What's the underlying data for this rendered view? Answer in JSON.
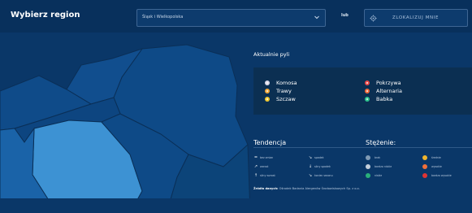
{
  "header": {
    "title": "Wybierz region",
    "region_select": {
      "value": "Śląsk i Wielkopolska"
    },
    "or_label": "lub",
    "locate_button": {
      "label": "ZLOKALIZUJ MNIE"
    }
  },
  "current_pollen": {
    "title": "Aktualnie pyli",
    "left": [
      {
        "name": "Komosa",
        "color": "#d8d8e8"
      },
      {
        "name": "Trawy",
        "color": "#f0a83c"
      },
      {
        "name": "Szczaw",
        "color": "#f0c830"
      }
    ],
    "right": [
      {
        "name": "Pokrzywa",
        "color": "#e84a4a"
      },
      {
        "name": "Alternaria",
        "color": "#f06a3c"
      },
      {
        "name": "Babka",
        "color": "#2ec48e"
      }
    ]
  },
  "trend": {
    "title": "Tendencja",
    "items": [
      {
        "symbol": "=",
        "text": "bez zmian"
      },
      {
        "symbol": "↘",
        "text": "spadek"
      },
      {
        "symbol": "↗",
        "text": "wzrost"
      },
      {
        "symbol": "↓",
        "text": "silny spadek"
      },
      {
        "symbol": "↑",
        "text": "silny wzrost"
      },
      {
        "symbol": "↘",
        "text": "koniec sezonu"
      }
    ]
  },
  "concentration": {
    "title": "Stężenie:",
    "items": [
      {
        "text": "brak",
        "color": "#7f9ab4"
      },
      {
        "text": "średnie",
        "color": "#f0b52d"
      },
      {
        "text": "bardzo niskie",
        "color": "#c3cfdc"
      },
      {
        "text": "wysokie",
        "color": "#f2703a"
      },
      {
        "text": "niskie",
        "color": "#2ab07a"
      },
      {
        "text": "bardzo wysokie",
        "color": "#e03434"
      }
    ]
  },
  "source": {
    "label": "Źródło danych:",
    "text": "Ośrodek Badania Alergenów Środowiskowych Sp. z o.o."
  },
  "colors": {
    "background": "#0a3768",
    "header": "#08305c",
    "map_dark": "#0e4a87",
    "map_mid": "#1a63a8",
    "map_light": "#3d92d3",
    "border": "#0a2f57"
  }
}
